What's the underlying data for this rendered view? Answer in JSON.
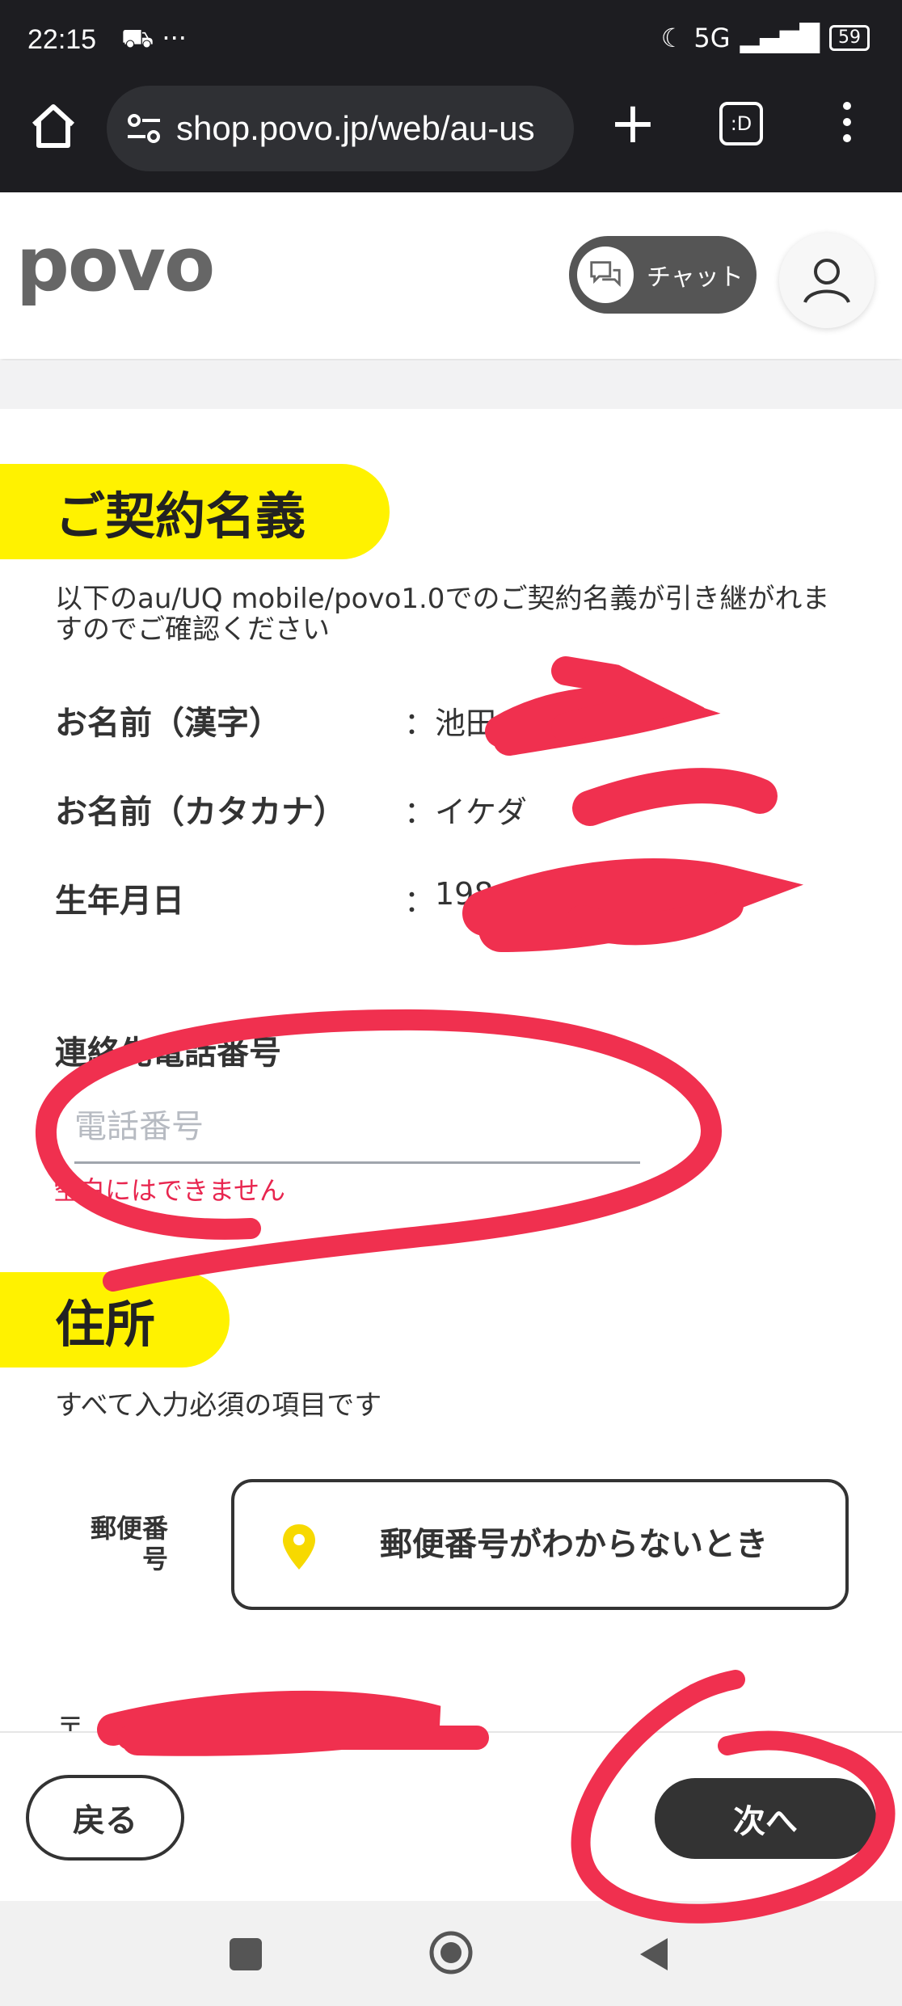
{
  "status_bar": {
    "time": "22:15",
    "left_icons": "⛟ ···",
    "network": "5G",
    "battery": "59"
  },
  "browser": {
    "url": "shop.povo.jp/web/au-us",
    "tabs_label": ":D"
  },
  "header": {
    "logo": "povo",
    "chat_label": "チャット"
  },
  "contract": {
    "title": "ご契約名義",
    "description": "以下のau/UQ mobile/povo1.0でのご契約名義が引き継がれますのでご確認ください",
    "rows": [
      {
        "label": "お名前（漢字）",
        "sep": "：",
        "value": "池田"
      },
      {
        "label": "お名前（カタカナ）",
        "sep": "：",
        "value": "イケダ"
      },
      {
        "label": "生年月日",
        "sep": "：",
        "value": "198"
      }
    ],
    "phone_label": "連絡先電話番号",
    "phone_placeholder": "電話番号",
    "phone_error": "空白にはできません"
  },
  "address": {
    "title": "住所",
    "description": "すべて入力必須の項目です",
    "zip_label": "郵便番号",
    "zip_help_button": "郵便番号がわからないとき",
    "postal_mark": "〒"
  },
  "actions": {
    "back": "戻る",
    "next": "次へ"
  },
  "colors": {
    "accent_yellow": "#fff200",
    "error": "#e8264f",
    "annotation_red": "#f0304f"
  }
}
